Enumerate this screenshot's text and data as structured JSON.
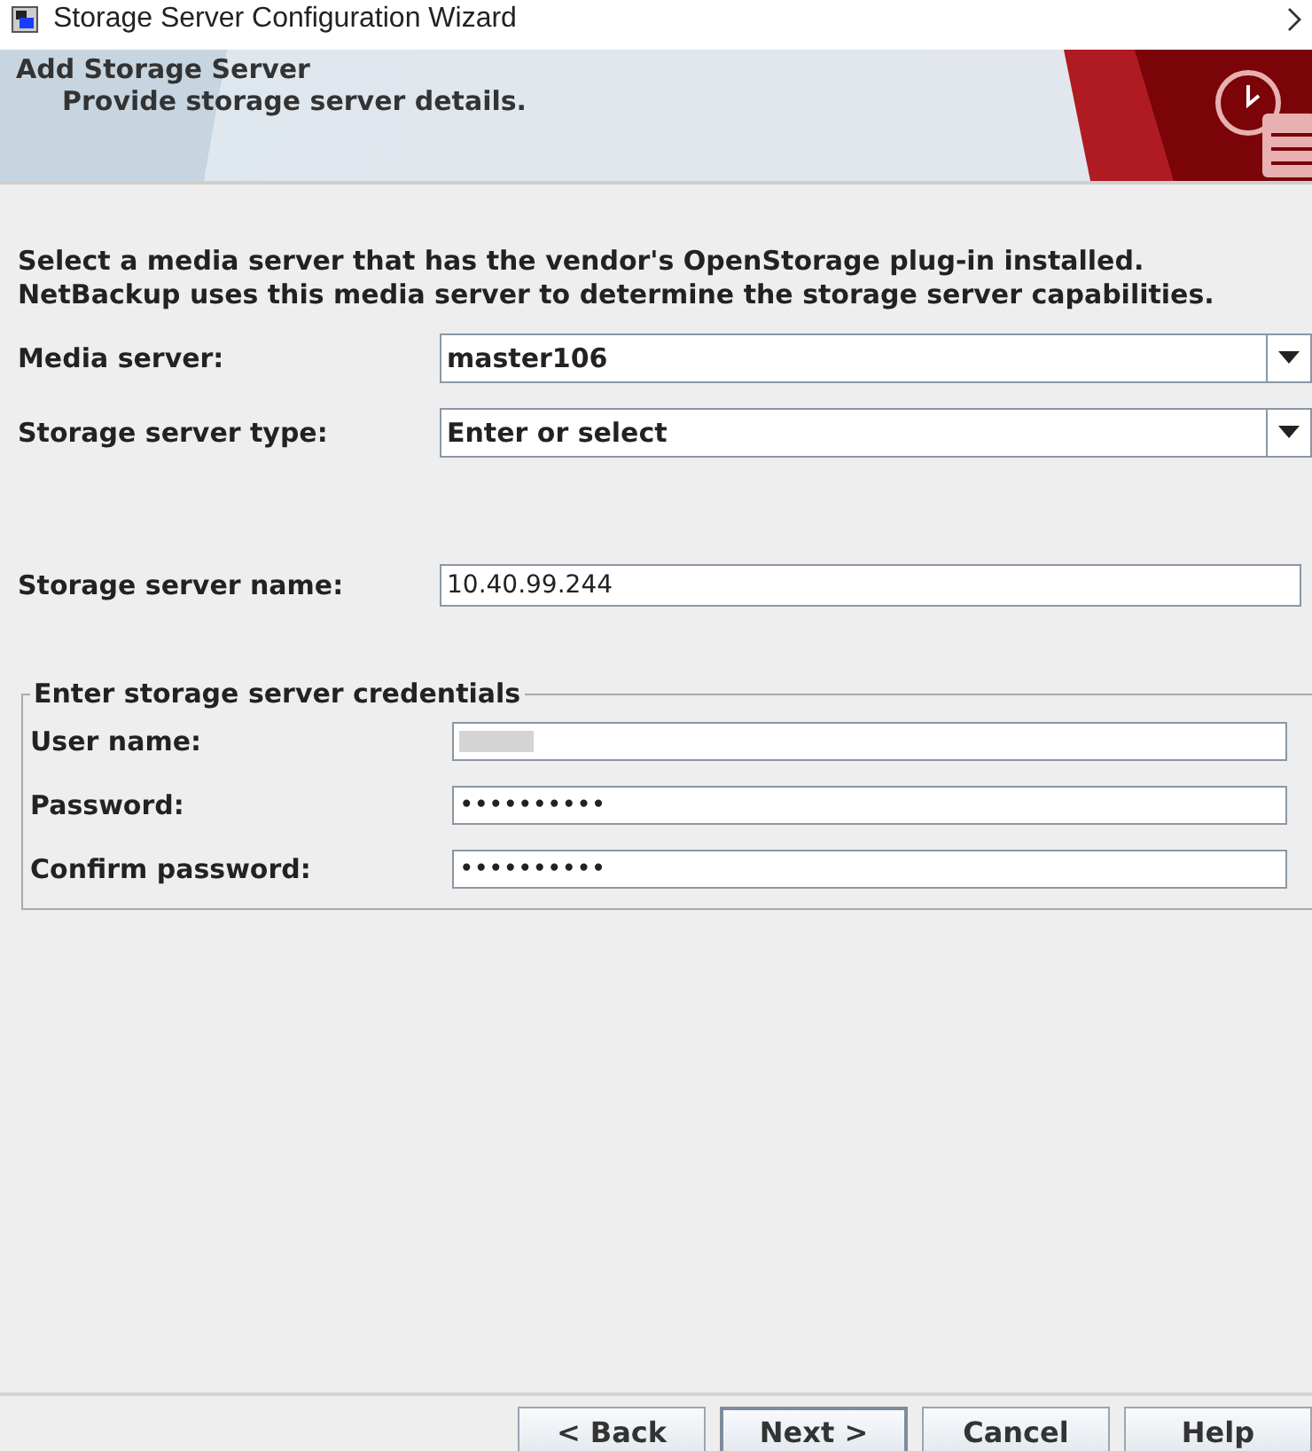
{
  "window": {
    "title": "Storage Server Configuration Wizard"
  },
  "header": {
    "title": "Add Storage Server",
    "subtitle": "Provide storage server details."
  },
  "intro": "Select a media server that has the vendor's OpenStorage plug-in installed. NetBackup uses this media server to determine the storage server capabilities.",
  "fields": [
    {
      "kind": "combo",
      "label": "Media server:",
      "value": "master106"
    },
    {
      "kind": "combo",
      "label": "Storage server type:",
      "value": "Enter or select"
    },
    {
      "kind": "text",
      "label": "Storage server name:",
      "value": "10.40.99.244"
    }
  ],
  "credentials": {
    "title": "Enter storage server credentials",
    "fields": [
      {
        "kind": "redacted",
        "label": "User name:"
      },
      {
        "kind": "text",
        "label": "Password:",
        "value": "••••••••••"
      },
      {
        "kind": "text",
        "label": "Confirm password:",
        "value": "••••••••••"
      }
    ]
  },
  "buttons": [
    "< Back",
    "Next >",
    "Cancel",
    "Help"
  ]
}
